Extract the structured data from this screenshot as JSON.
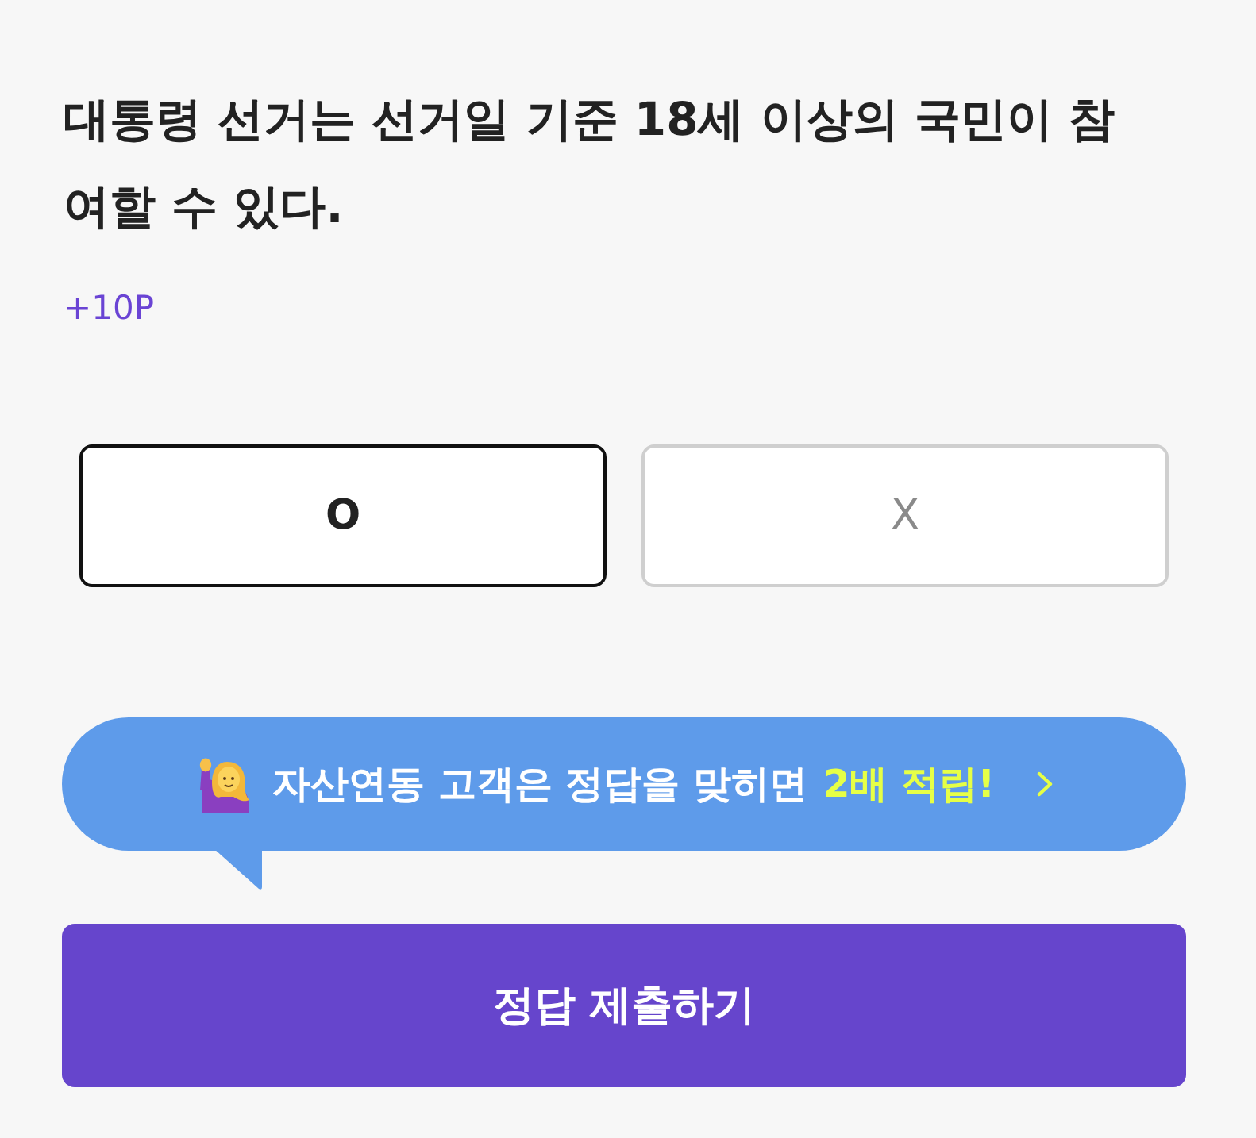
{
  "question": {
    "text": "대통령 선거는 선거일 기준 18세 이상의 국민이 참여할 수 있다.",
    "points": "+10P"
  },
  "options": [
    {
      "label": "O",
      "selected": true
    },
    {
      "label": "X",
      "selected": false
    }
  ],
  "promo": {
    "text": "자산연동 고객은 정답을 맞히면",
    "highlight": "2배 적립!"
  },
  "submit": {
    "label": "정답 제출하기"
  }
}
